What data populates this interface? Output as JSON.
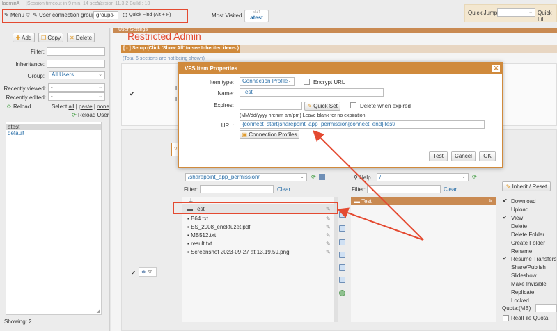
{
  "topbar": {
    "user": "ladminA",
    "session_info": "[Session timeout in 9 min, 14 secs.]",
    "version": "Version 11.3.2 Build : 10",
    "menu_label": "Menu",
    "group_label": "User connection group:",
    "group_value": "groupa",
    "quick_find": "Quick Find (Alt + F)",
    "most_visited_label": "Most Visited :",
    "most_visited_alt": "alt+1",
    "most_visited_item": "atest",
    "quick_jump_label": "Quick Jump:",
    "quick_fill_label": "Quick Fil"
  },
  "left_panel": {
    "add": "Add",
    "copy": "Copy",
    "delete": "Delete",
    "filter_label": "Filter:",
    "inheritance_label": "Inheritance:",
    "group_label": "Group:",
    "group_value": "All Users",
    "recently_viewed": "Recently viewed:",
    "recently_edited": "Recently edited:",
    "dash": "-",
    "reload": "Reload",
    "select_label": "Select",
    "select_all": "all",
    "select_paste": "paste",
    "select_none": "none",
    "reload_user": "Reload User",
    "users": [
      "atest",
      "default"
    ],
    "showing": "Showing: 2"
  },
  "main": {
    "section_title": "User Settings",
    "restricted": "Restricted Admin",
    "setup_header": "[ - ] Setup (Click 'Show All' to see Inherited items.)",
    "total_sections": "(Total 6 sections are not being shown)",
    "dir_path": "/sharepoint_app_permission/",
    "filter_label": "Filter:",
    "clear": "Clear",
    "files": [
      "Test",
      "B64.txt",
      "ES_2008_enekfuzet.pdf",
      "MB512.txt",
      "result.txt",
      "Screenshot 2023-09-27 at 13.19.59.png"
    ],
    "right_path": "/",
    "help": "Help",
    "right_filter_label": "Filter:",
    "right_clear": "Clear",
    "right_item": "Test",
    "inherit_reset": "Inherit / Reset",
    "permissions": [
      {
        "label": "Download",
        "checked": true
      },
      {
        "label": "Upload",
        "checked": false
      },
      {
        "label": "View",
        "checked": true
      },
      {
        "label": "Delete",
        "checked": false
      },
      {
        "label": "Delete Folder",
        "checked": false
      },
      {
        "label": "Create Folder",
        "checked": false
      },
      {
        "label": "Rename",
        "checked": false
      },
      {
        "label": "Resume Transfers",
        "checked": true
      },
      {
        "label": "Share/Publish",
        "checked": false
      },
      {
        "label": "Slideshow",
        "checked": false
      },
      {
        "label": "Make Invisible",
        "checked": false
      },
      {
        "label": "Replicate",
        "checked": false
      },
      {
        "label": "Locked",
        "checked": false
      }
    ],
    "quota_label": "Quota:(MB)",
    "realfile_quota": "RealFile Quota"
  },
  "dialog": {
    "title": "VFS Item Properties",
    "item_type_label": "Item type:",
    "item_type_value": "Connection Profile",
    "encrypt_url": "Encrypt URL",
    "name_label": "Name:",
    "name_value": "Test",
    "expires_label": "Expires:",
    "quick_set": "Quick Set",
    "delete_when_expired": "Delete when expired",
    "expires_hint": "(MM/dd/yyyy hh:mm am/pm) Leave blank for no expiration.",
    "url_label": "URL:",
    "url_value": "{connect_start}sharepoint_app_permission{connect_end}Test/",
    "connection_profiles": "Connection Profiles",
    "test": "Test",
    "cancel": "Cancel",
    "ok": "OK"
  },
  "colors": {
    "annotation": "#e44a31",
    "header_orange": "#d08a3c",
    "link_blue": "#2a6fa8"
  }
}
